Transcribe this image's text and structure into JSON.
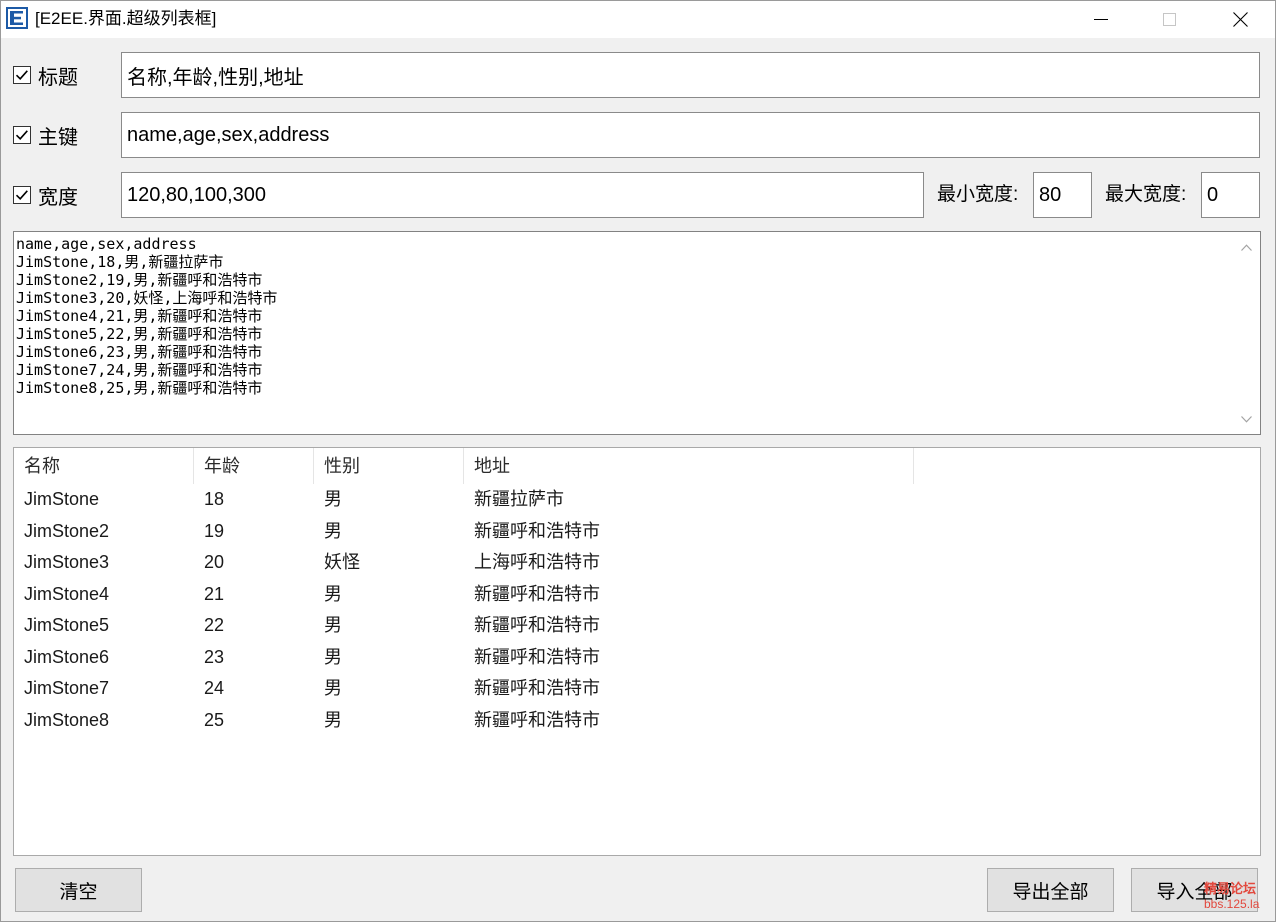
{
  "window": {
    "title": "[E2EE.界面.超级列表框]",
    "app_icon": "e-language-app-icon",
    "maximize_enabled": false
  },
  "fields": {
    "title": {
      "label": "标题",
      "checked": true,
      "value": "名称,年龄,性别,地址"
    },
    "key": {
      "label": "主键",
      "checked": true,
      "value": "name,age,sex,address"
    },
    "width": {
      "label": "宽度",
      "checked": true,
      "value": "120,80,100,300"
    },
    "min_width": {
      "label": "最小宽度:",
      "value": "80"
    },
    "max_width": {
      "label": "最大宽度:",
      "value": "0"
    }
  },
  "text_box": {
    "lines": [
      "name,age,sex,address",
      "JimStone,18,男,新疆拉萨市",
      "JimStone2,19,男,新疆呼和浩特市",
      "JimStone3,20,妖怪,上海呼和浩特市",
      "JimStone4,21,男,新疆呼和浩特市",
      "JimStone5,22,男,新疆呼和浩特市",
      "JimStone6,23,男,新疆呼和浩特市",
      "JimStone7,24,男,新疆呼和浩特市",
      "JimStone8,25,男,新疆呼和浩特市"
    ]
  },
  "list": {
    "columns": [
      "名称",
      "年龄",
      "性别",
      "地址"
    ],
    "rows": [
      [
        "JimStone",
        "18",
        "男",
        "新疆拉萨市"
      ],
      [
        "JimStone2",
        "19",
        "男",
        "新疆呼和浩特市"
      ],
      [
        "JimStone3",
        "20",
        "妖怪",
        "上海呼和浩特市"
      ],
      [
        "JimStone4",
        "21",
        "男",
        "新疆呼和浩特市"
      ],
      [
        "JimStone5",
        "22",
        "男",
        "新疆呼和浩特市"
      ],
      [
        "JimStone6",
        "23",
        "男",
        "新疆呼和浩特市"
      ],
      [
        "JimStone7",
        "24",
        "男",
        "新疆呼和浩特市"
      ],
      [
        "JimStone8",
        "25",
        "男",
        "新疆呼和浩特市"
      ]
    ]
  },
  "buttons": {
    "clear": "清空",
    "export_all": "导出全部",
    "import_all": "导入全部"
  },
  "watermark": {
    "line1": "精易论坛",
    "line2": "bbs.125.la"
  },
  "colors": {
    "window_background": "#f0f0f0",
    "field_border": "#8a8a8a",
    "button_background": "#e1e1e1",
    "button_border": "#adadad",
    "watermark": "#e2483d"
  }
}
